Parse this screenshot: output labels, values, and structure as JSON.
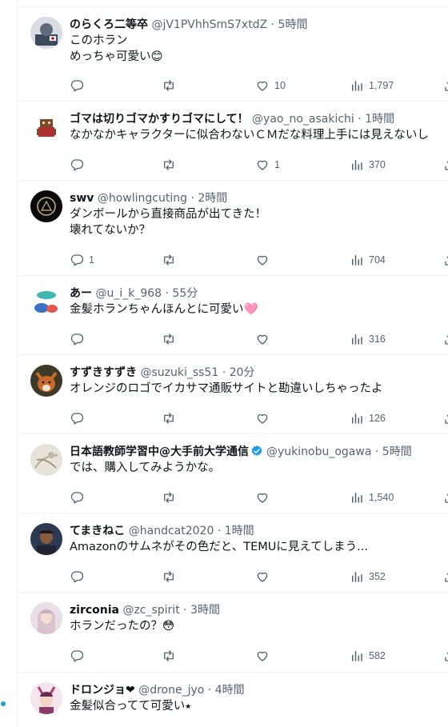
{
  "colors": {
    "accent": "#1d9bf0",
    "muted": "#536471",
    "text": "#0f1419",
    "divider": "#eff3f4"
  },
  "icons": {
    "reply": "reply-icon",
    "retweet": "retweet-icon",
    "like": "heart-icon",
    "views": "views-icon",
    "share": "share-icon",
    "verified": "verified-badge-icon"
  },
  "tweets": [
    {
      "name": "のらくろ二等卒",
      "handle": "@jV1PVhhSmS7xtdZ",
      "sep": " · ",
      "time": "5時間",
      "text": "このホラン\nめっちゃ可愛い😊",
      "replies": "",
      "retweets": "",
      "likes": "10",
      "views": "1,797"
    },
    {
      "name": "ゴマは切りゴマかすりゴマにして！",
      "handle": "@yao_no_asakichi",
      "sep": " · ",
      "time": "1時間",
      "text": "なかなかキャラクターに似合わないＣＭだな料理上手には見えないし",
      "replies": "",
      "retweets": "",
      "likes": "1",
      "views": "370"
    },
    {
      "name": "swv",
      "handle": "@howlingcuting",
      "sep": " · ",
      "time": "2時間",
      "text": "ダンボールから直接商品が出てきた！\n壊れてないか？",
      "replies": "1",
      "retweets": "",
      "likes": "",
      "views": "704"
    },
    {
      "name": "あー",
      "handle": "@u_i_k_968",
      "sep": " · ",
      "time": "55分",
      "text": "金髪ホランちゃんほんとに可愛い🩷",
      "replies": "",
      "retweets": "",
      "likes": "",
      "views": "316"
    },
    {
      "name": "すずきすずき",
      "handle": "@suzuki_ss51",
      "sep": " · ",
      "time": "20分",
      "text": "オレンジのロゴでイカサマ通販サイトと勘違いしちゃったよ",
      "replies": "",
      "retweets": "",
      "likes": "",
      "views": "126"
    },
    {
      "name": "日本語教師学習中@大手前大学通信",
      "handle": "@yukinobu_ogawa",
      "sep": " · ",
      "time": "5時間",
      "text": "では、購入してみようかな。",
      "replies": "",
      "retweets": "",
      "likes": "",
      "views": "1,540",
      "verified": true
    },
    {
      "name": "てまきねこ",
      "handle": "@handcat2020",
      "sep": " · ",
      "time": "1時間",
      "text": "Amazonのサムネがその色だと、TEMUに見えてしまう...",
      "replies": "",
      "retweets": "",
      "likes": "",
      "views": "352"
    },
    {
      "name": "zirconia",
      "handle": "@zc_spirit",
      "sep": " · ",
      "time": "3時間",
      "text": "ホランだったの？😳",
      "replies": "",
      "retweets": "",
      "likes": "",
      "views": "582"
    },
    {
      "name": "ドロンジョ❤",
      "handle": "@drone_jyo",
      "sep": " · ",
      "time": "4時間",
      "text": "金髪似合ってて可愛い⭑",
      "replies": "",
      "retweets": "",
      "likes": "",
      "views": ""
    }
  ]
}
